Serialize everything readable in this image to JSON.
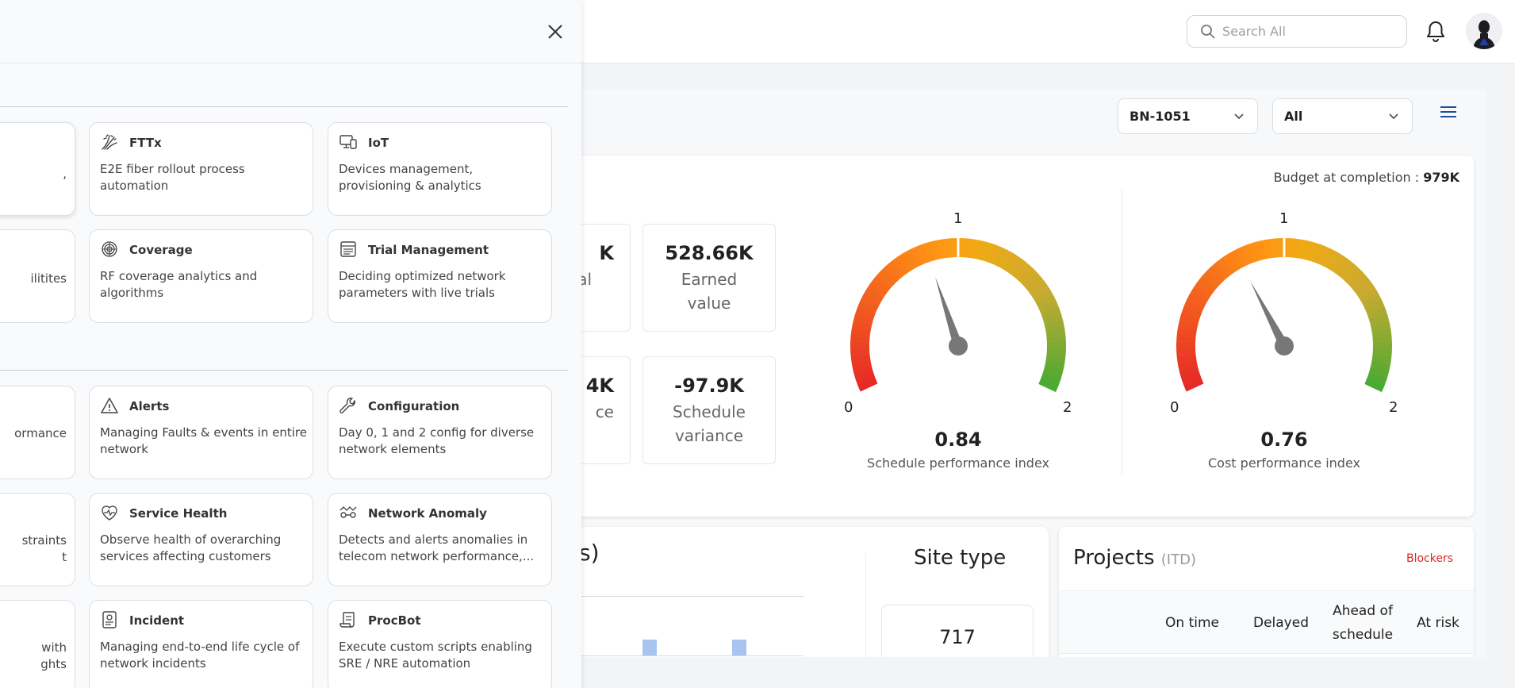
{
  "header": {
    "search_placeholder": "Search All"
  },
  "filters": {
    "project_select": "BN-1051",
    "scope_select": "All"
  },
  "evm": {
    "budget_label": "Budget at completion :",
    "budget_value": "979K",
    "metrics": [
      {
        "value": "K",
        "label": "al"
      },
      {
        "value": "528.66K",
        "label": "Earned value"
      },
      {
        "value": "4K",
        "label": "ce"
      },
      {
        "value": "-97.9K",
        "label": "Schedule variance"
      }
    ],
    "gauges": [
      {
        "min": "0",
        "mid": "1",
        "max": "2",
        "value": 0.84,
        "value_text": "0.84",
        "label": "Schedule performance index"
      },
      {
        "min": "0",
        "mid": "1",
        "max": "2",
        "value": 0.76,
        "value_text": "0.76",
        "label": "Cost performance index"
      }
    ]
  },
  "chart_card": {
    "title_fragment": "s)",
    "bar_fractions": [
      0.26,
      0.26
    ]
  },
  "site_type": {
    "title": "Site type",
    "count": "717"
  },
  "projects": {
    "title": "Projects",
    "subtitle": "(ITD)",
    "blockers_link": "Blockers",
    "columns": [
      "On time",
      "Delayed",
      "Ahead of schedule",
      "At risk"
    ]
  },
  "drawer": {
    "partial_tiles": [
      {
        "desc": ","
      },
      {
        "desc": "ilitites"
      },
      {
        "desc": "ormance"
      },
      {
        "desc": "straints\nt"
      },
      {
        "desc": "with\nghts"
      }
    ],
    "tiles": [
      {
        "icon": "fiber-icon",
        "title": "FTTx",
        "desc": "E2E fiber rollout process automation"
      },
      {
        "icon": "devices-icon",
        "title": "IoT",
        "desc": "Devices management, provisioning & analytics"
      },
      {
        "icon": "coverage-icon",
        "title": "Coverage",
        "desc": "RF coverage analytics and algorithms"
      },
      {
        "icon": "trial-icon",
        "title": "Trial Management",
        "desc": "Deciding optimized network parameters with live trials"
      },
      {
        "icon": "warning-icon",
        "title": "Alerts",
        "desc": "Managing Faults & events in entire network"
      },
      {
        "icon": "wrench-icon",
        "title": "Configuration",
        "desc": "Day 0, 1 and 2 config for diverse network elements"
      },
      {
        "icon": "heart-pulse-icon",
        "title": "Service Health",
        "desc": "Observe health of overarching services affecting customers"
      },
      {
        "icon": "anomaly-icon",
        "title": "Network Anomaly",
        "desc": "Detects and alerts anomalies in telecom network performance,..."
      },
      {
        "icon": "incident-icon",
        "title": "Incident",
        "desc": "Managing end-to-end life cycle of network incidents"
      },
      {
        "icon": "script-icon",
        "title": "ProcBot",
        "desc": "Execute custom scripts enabling SRE / NRE automation"
      }
    ]
  }
}
